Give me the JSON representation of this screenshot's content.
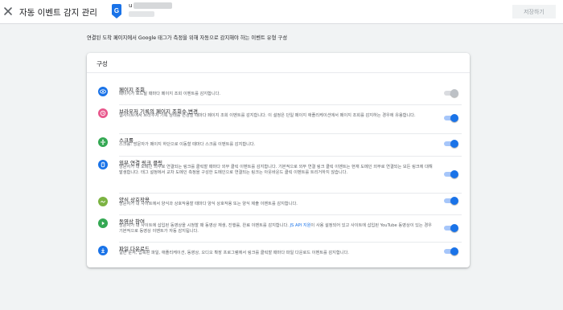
{
  "header": {
    "title": "자동 이벤트 감지 관리",
    "account_initial": "u",
    "save_label": "저장하기"
  },
  "intro_text": "연결된 도착 페이지에서 Google 태그가 측정을 위해 자동으로 감지해야 하는 이벤트 유형 구성",
  "card": {
    "title": "구성",
    "items": [
      {
        "title": "페이지 조회",
        "desc": "페이지가 로드될 때마다 페이지 조회 이벤트를 감지합니다.",
        "icon": "eye-icon",
        "enabled": false
      },
      {
        "title": "브라우저 기록의 페이지 조회수 변경",
        "desc": "웹사이트에서 브라우저 기록 상태를 변경할 때마다 페이지 조회 이벤트를 감지합니다. 이 설정은 단일 페이지 애플리케이션에서 페이지 조회를 감지하는 경우에 유용합니다.",
        "icon": "history-icon",
        "enabled": true
      },
      {
        "title": "스크롤",
        "desc": "스크롤: 방문자가 페이지 하단으로 이동할 때마다 스크롤 이벤트를 감지합니다.",
        "icon": "scroll-icon",
        "enabled": true
      },
      {
        "title": "외부 연결 링크 클릭",
        "desc": "방문자가 내 도메인 외부로 연결되는 링크를 클릭할 때마다 외부 클릭 이벤트를 감지합니다. 기본적으로 외부 연결 링크 클릭 이벤트는 현재 도메인 외부로 연결되는 모든 링크에 대해 발생합니다. 태그 설정에서 교차 도메인 측정을 구성한 도메인으로 연결되는 링크는 아웃바운드 클릭 이벤트를 트리거하지 않습니다.",
        "icon": "outbound-link-icon",
        "enabled": true
      },
      {
        "title": "양식 상호작용",
        "desc": "방문자가 내 사이트에서 양식과 상호작용할 때마다 양식 상호작용 또는 양식 제출 이벤트를 감지합니다.",
        "icon": "form-icon",
        "enabled": true
      },
      {
        "title": "동영상 참여",
        "desc_before": "방문자가 내 사이트에 삽입된 동영상을 시청할 때 동영상 재생, 진행률, 완료 이벤트를 감지합니다.",
        "desc_link": "JS API 지원",
        "desc_after": "이 사용 설정되어 있고 사이트에 삽입된 YouTube 동영상이 있는 경우 기본적으로 동영상 이벤트가 자동 감지됩니다.",
        "icon": "play-icon",
        "enabled": true
      },
      {
        "title": "파일 다운로드",
        "desc": "일반 문서, 압축된 파일, 애플리케이션, 동영상, 오디오 확장 프로그램에서 링크를 클릭할 때마다 파일 다운로드 이벤트를 감지합니다.",
        "icon": "download-icon",
        "enabled": true
      }
    ]
  },
  "colors": {
    "accent": "#1a73e8",
    "icon_blue": "#1a73e8",
    "icon_pink": "#e8578c",
    "icon_green": "#34a853",
    "icon_olive": "#7cb342"
  }
}
